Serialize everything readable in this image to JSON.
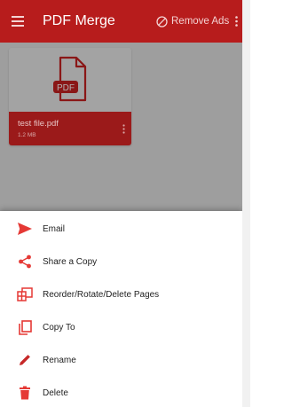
{
  "app_bar": {
    "title": "PDF Merge",
    "remove_ads_label": "Remove Ads",
    "menu_icon": "hamburger-menu-icon",
    "remove_ads_icon": "block-icon",
    "overflow_icon": "more-vert-icon"
  },
  "file": {
    "name": "test file.pdf",
    "size": "1.2 MB",
    "badge": "PDF"
  },
  "sheet": {
    "items": [
      {
        "label": "Email",
        "icon": "send-icon"
      },
      {
        "label": "Share a Copy",
        "icon": "share-icon"
      },
      {
        "label": "Reorder/Rotate/Delete Pages",
        "icon": "reorder-pages-icon"
      },
      {
        "label": "Copy To",
        "icon": "copy-icon"
      },
      {
        "label": "Rename",
        "icon": "pencil-icon"
      },
      {
        "label": "Delete",
        "icon": "trash-icon"
      }
    ]
  },
  "colors": {
    "primary": "#b71c1c",
    "accent": "#e53935",
    "scrim": "#9e9e9e"
  }
}
